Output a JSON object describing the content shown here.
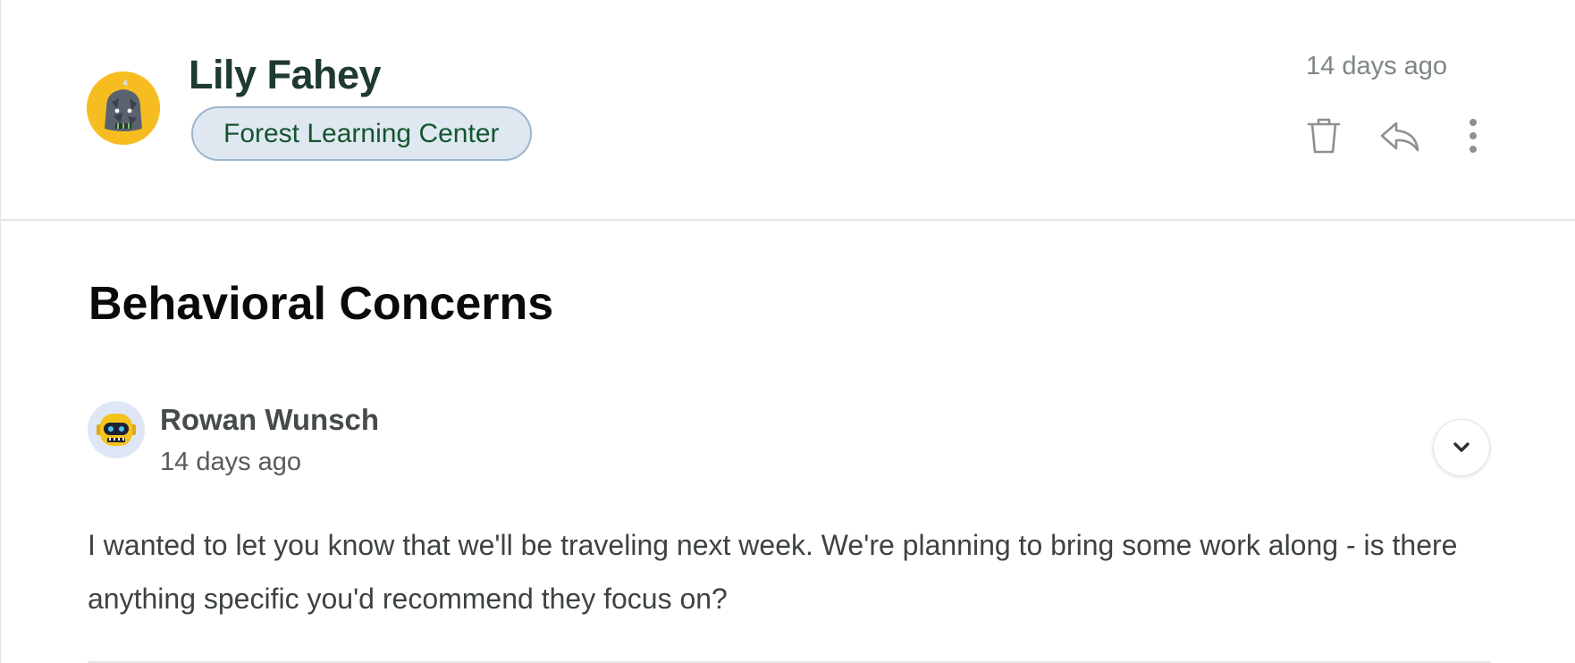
{
  "header": {
    "sender_name": "Lily Fahey",
    "school": "Forest Learning Center",
    "time": "14 days ago",
    "actions": {
      "delete_icon": "trash-icon",
      "reply_icon": "reply-arrow-icon",
      "more_icon": "vertical-dots-icon"
    }
  },
  "message": {
    "subject": "Behavioral Concerns",
    "author": "Rowan Wunsch",
    "time": "14 days ago",
    "body": "I wanted to let you know that we'll be traveling next week. We're planning to bring some work along - is there anything specific you'd recommend they focus on?",
    "expand_icon": "chevron-down-icon"
  },
  "colors": {
    "sender_name": "#1f3a30",
    "chip_background": "#dfe8f0",
    "chip_border": "#9db5cc",
    "chip_text": "#15552f",
    "sender_avatar_bg": "#f7bd20",
    "author_avatar_bg": "#dfe7f7",
    "muted_text": "#7d8784"
  }
}
